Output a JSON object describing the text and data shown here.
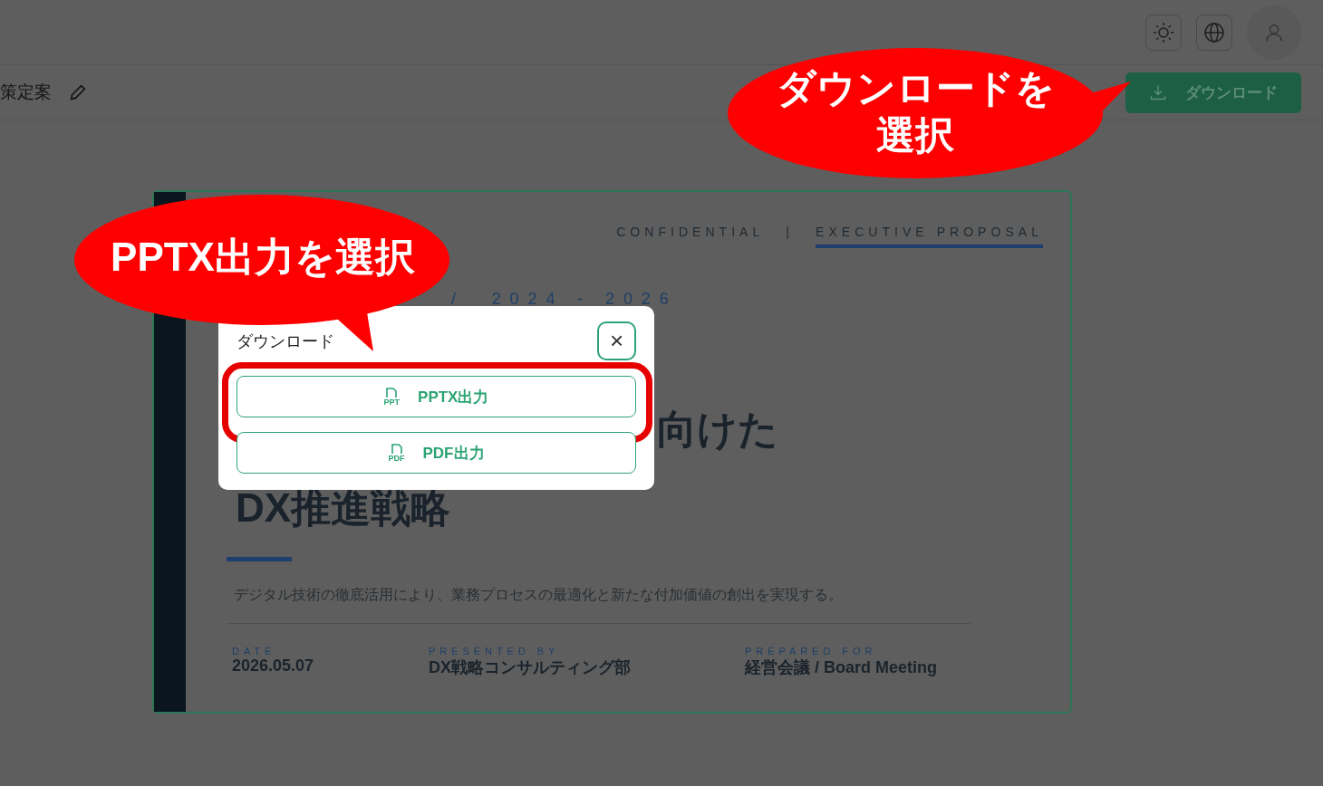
{
  "toolbar": {
    "title": "策定案",
    "download_button": "ダウンロード"
  },
  "slide": {
    "tag_left": "CONFIDENTIAL",
    "separator": "|",
    "tag_right": "EXECUTIVE PROPOSAL",
    "period": "/  2024 - 2026",
    "title_line_1": "向けた",
    "title_line_2": "DX推進戦略",
    "subtitle": "デジタル技術の徹底活用により、業務プロセスの最適化と新たな付加価値の創出を実現する。",
    "meta": [
      {
        "label": "DATE",
        "value": "2026.05.07"
      },
      {
        "label": "PRESENTED BY",
        "value": "DX戦略コンサルティング部"
      },
      {
        "label": "PREPARED FOR",
        "value": "経営会議 / Board Meeting"
      }
    ]
  },
  "dialog": {
    "title": "ダウンロード",
    "close": "×",
    "options": [
      {
        "label": "PPTX出力",
        "badge": "PPT",
        "highlighted": true
      },
      {
        "label": "PDF出力",
        "badge": "PDF",
        "highlighted": false
      }
    ]
  },
  "callouts": [
    {
      "text": "PPTX出力を選択",
      "kind": "left"
    },
    {
      "text": "ダウンロードを選択",
      "kind": "right"
    }
  ]
}
